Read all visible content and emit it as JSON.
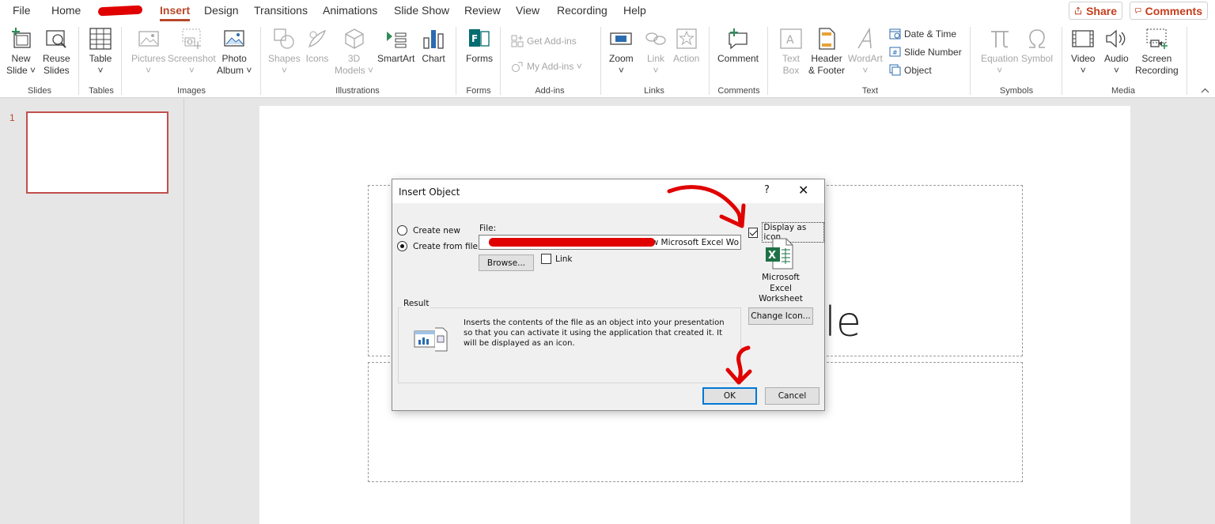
{
  "menu": {
    "tabs": [
      "File",
      "Home",
      "Insert",
      "Design",
      "Transitions",
      "Animations",
      "Slide Show",
      "Review",
      "View",
      "Recording",
      "Help"
    ],
    "active": "Insert",
    "share_label": "Share",
    "comments_label": "Comments"
  },
  "ribbon": {
    "groups": {
      "slides": "Slides",
      "tables": "Tables",
      "images": "Images",
      "illustrations": "Illustrations",
      "forms": "Forms",
      "addins": "Add-ins",
      "links": "Links",
      "comments": "Comments",
      "text": "Text",
      "symbols": "Symbols",
      "media": "Media"
    },
    "commands": {
      "new_slide": [
        "New",
        "Slide ˅"
      ],
      "reuse_slides": [
        "Reuse",
        "Slides"
      ],
      "table": [
        "Table",
        "˅"
      ],
      "pictures": [
        "Pictures",
        "˅"
      ],
      "screenshot": [
        "Screenshot",
        "˅"
      ],
      "photo_album": [
        "Photo",
        "Album ˅"
      ],
      "shapes": [
        "Shapes",
        "˅"
      ],
      "icons": [
        "Icons",
        ""
      ],
      "models": [
        "3D",
        "Models ˅"
      ],
      "smartart": [
        "SmartArt",
        ""
      ],
      "chart": [
        "Chart",
        ""
      ],
      "forms": [
        "Forms",
        ""
      ],
      "get_addins": "Get Add-ins",
      "my_addins": "My Add-ins  ˅",
      "zoom": [
        "Zoom",
        "˅"
      ],
      "link": [
        "Link",
        "˅"
      ],
      "action": [
        "Action",
        ""
      ],
      "comment": [
        "Comment",
        ""
      ],
      "text_box": [
        "Text",
        "Box"
      ],
      "header_footer": [
        "Header",
        "& Footer"
      ],
      "wordart": [
        "WordArt",
        "˅"
      ],
      "date_time": "Date & Time",
      "slide_number": "Slide Number",
      "object": "Object",
      "equation": [
        "Equation",
        "˅"
      ],
      "symbol": [
        "Symbol",
        ""
      ],
      "video": [
        "Video",
        "˅"
      ],
      "audio": [
        "Audio",
        "˅"
      ],
      "screen_recording": [
        "Screen",
        "Recording"
      ]
    }
  },
  "thumbnails": {
    "slide_number": "1"
  },
  "slide": {
    "title_fragment": "tle"
  },
  "dialog": {
    "title": "Insert Object",
    "help": "?",
    "close": "✕",
    "create_new": "Create new",
    "create_from_file": "Create from file",
    "selected_mode": "Create from file",
    "file_label": "File:",
    "file_value": "\\New Microsoft Excel Wo",
    "browse": "Browse...",
    "link_label": "Link",
    "link_checked": false,
    "display_as_icon": "Display as icon",
    "display_as_icon_checked": true,
    "icon_caption": [
      "Microsoft",
      "Excel",
      "Worksheet"
    ],
    "change_icon": "Change Icon...",
    "result_label": "Result",
    "result_text": "Inserts the contents of the file as an object into your presentation so that you can activate it using the application that created it. It will be displayed as an icon.",
    "ok": "OK",
    "cancel": "Cancel"
  },
  "colors": {
    "accent": "#b7472a",
    "annotation_red": "#e00000",
    "excel_green": "#1e7145"
  }
}
